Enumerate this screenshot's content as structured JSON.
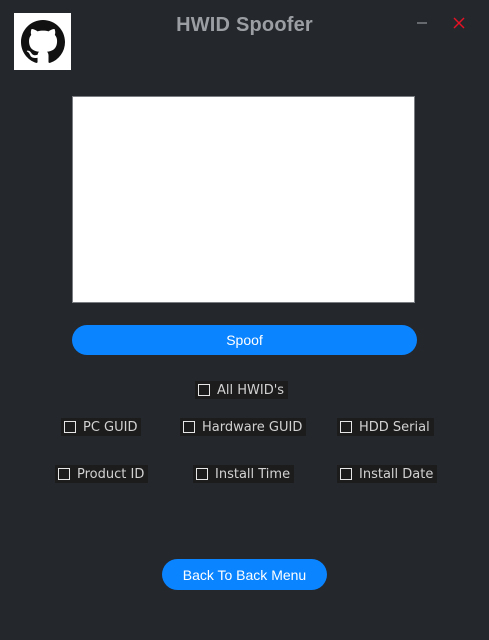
{
  "window": {
    "title": "HWID Spoofer"
  },
  "titlebar": {
    "logo_icon": "github-icon",
    "minimize_icon": "minimize-icon",
    "close_icon": "close-icon",
    "close_color": "#e81123"
  },
  "output": {
    "value": ""
  },
  "actions": {
    "spoof_label": "Spoof",
    "back_label": "Back To Back Menu",
    "accent_color": "#0a84ff"
  },
  "options": {
    "all_hwids": {
      "label": "All HWID's",
      "checked": false
    },
    "pc_guid": {
      "label": "PC GUID",
      "checked": false
    },
    "hardware_guid": {
      "label": "Hardware GUID",
      "checked": false
    },
    "hdd_serial": {
      "label": "HDD Serial",
      "checked": false
    },
    "product_id": {
      "label": "Product ID",
      "checked": false
    },
    "install_time": {
      "label": "Install Time",
      "checked": false
    },
    "install_date": {
      "label": "Install Date",
      "checked": false
    }
  }
}
